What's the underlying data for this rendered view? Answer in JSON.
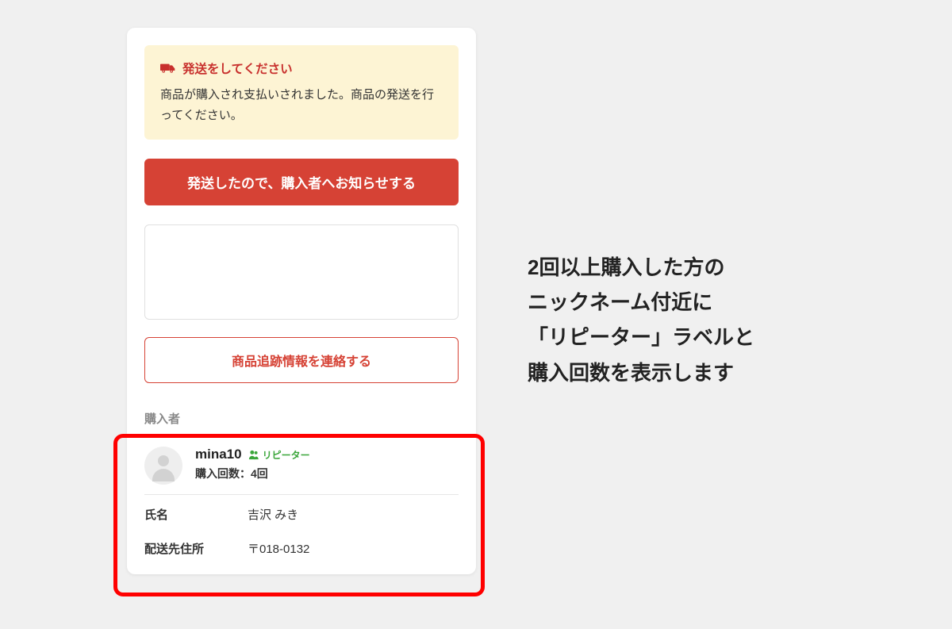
{
  "notice": {
    "heading": "発送をしてください",
    "body": "商品が購入され支払いされました。商品の発送を行ってください。"
  },
  "buttons": {
    "primary": "発送したので、購入者へお知らせする",
    "secondary": "商品追跡情報を連絡する"
  },
  "buyer": {
    "section_label": "購入者",
    "nickname": "mina10",
    "repeater_label": "リピーター",
    "purchase_count": "購入回数：4回"
  },
  "details": {
    "name_label": "氏名",
    "name_value": "吉沢 みき",
    "address_label": "配送先住所",
    "address_value": "〒018-0132"
  },
  "annotation": {
    "line1": "2回以上購入した方の",
    "line2": "ニックネーム付近に",
    "line3": "「リピーター」ラベルと",
    "line4": "購入回数を表示します"
  }
}
